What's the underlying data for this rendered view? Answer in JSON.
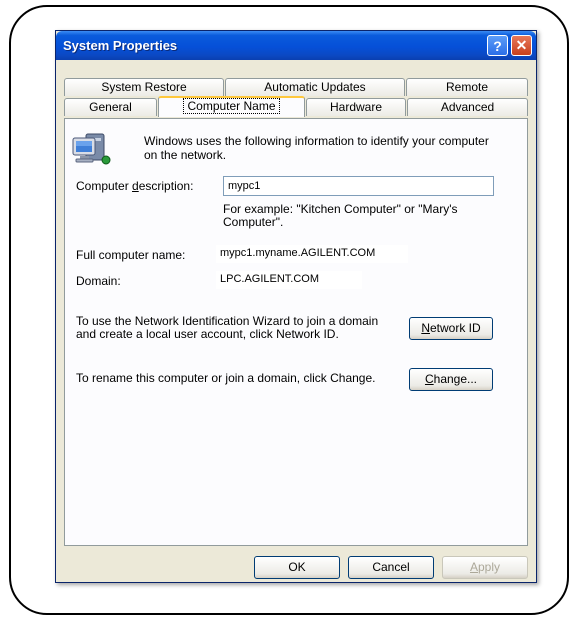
{
  "window": {
    "title": "System Properties",
    "help_glyph": "?",
    "close_glyph": "✕"
  },
  "tabs": {
    "row1": [
      "System Restore",
      "Automatic Updates",
      "Remote"
    ],
    "row2": [
      "General",
      "Computer Name",
      "Hardware",
      "Advanced"
    ],
    "selected": "Computer Name"
  },
  "panel": {
    "intro": "Windows uses the following information to identify your computer on the network.",
    "description": {
      "label_pre": "Computer ",
      "label_key": "d",
      "label_post": "escription:",
      "value": "mypc1"
    },
    "example": "For example: \"Kitchen Computer\" or \"Mary's Computer\".",
    "full_name": {
      "label": "Full computer name:",
      "value": "mypc1.myname.AGILENT.COM"
    },
    "domain": {
      "label": "Domain:",
      "value": "LPC.AGILENT.COM"
    },
    "network_text": "To use the Network Identification Wizard to join a domain and create a local user account, click Network ID.",
    "network_button": {
      "key": "N",
      "rest": "etwork ID"
    },
    "rename_text": "To rename this computer or join a domain, click Change.",
    "change_button": {
      "key": "C",
      "rest": "hange..."
    }
  },
  "footer": {
    "ok": "OK",
    "cancel": "Cancel",
    "apply_key": "A",
    "apply_rest": "pply"
  }
}
